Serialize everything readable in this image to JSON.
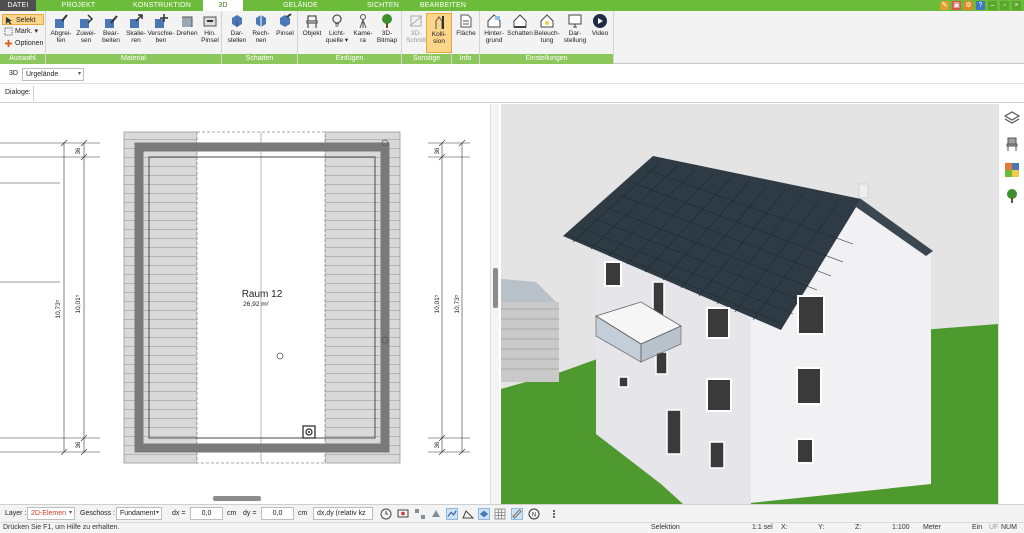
{
  "tabs": [
    {
      "label": "DATEI"
    },
    {
      "label": "PROJEKT"
    },
    {
      "label": "KONSTRUKTION"
    },
    {
      "label": "3D"
    },
    {
      "label": "GELÄNDE"
    },
    {
      "label": "SICHTEN"
    },
    {
      "label": "BEARBEITEN"
    }
  ],
  "window_controls": [
    "–",
    "▫",
    "×"
  ],
  "ribbon": {
    "auswahl": {
      "label": "Auswahl",
      "selekt": "Selekt",
      "mark": "Mark. ▾",
      "optionen": "Optionen"
    },
    "material": {
      "label": "Material",
      "buttons": [
        "Abgrei-\nfen",
        "Zuwei-\nsen",
        "Bear-\nbeiten",
        "Skalie-\nren",
        "Verschie-\nben",
        "Drehen",
        "Hin.\nPinsel"
      ]
    },
    "schatten": {
      "label": "Schatten",
      "buttons": [
        "Dar-\nstellen",
        "Rech-\nnen",
        "Pinsel"
      ]
    },
    "einfuegen": {
      "label": "Einfügen",
      "buttons": [
        "Objekt",
        "Licht-\nquelle ▾",
        "Kame-\nra",
        "3D-\nBitmap"
      ]
    },
    "sonstige": {
      "label": "Sonstige",
      "buttons": [
        "3D-\nSchnitt",
        "Kolli-\nsion"
      ]
    },
    "info": {
      "label": "Info",
      "buttons": [
        "Fläche"
      ]
    },
    "einstellungen": {
      "label": "Einstellungen",
      "buttons": [
        "Hinter-\ngrund",
        "Schatten",
        "Beleuch-\ntung",
        "Dar-\nstellung",
        "Video"
      ]
    }
  },
  "subbar": {
    "view_mode": "3D",
    "terrain_select": "Urgelände",
    "dialoge": "Dialoge:"
  },
  "plan": {
    "room_name": "Raum 12",
    "room_area": "26,92 m²",
    "dim_outer": "10,73⁵",
    "dim_inner": "10,01⁵",
    "dim_small": "36"
  },
  "bottombar": {
    "layer_label": "Layer :",
    "layer_value": "2D-Elemen",
    "geschoss_label": "Geschoss :",
    "geschoss_value": "Fundament",
    "dx_label": "dx =",
    "dx_value": "0,0",
    "dy_label": "dy =",
    "dy_value": "0,0",
    "unit": "cm",
    "mode_value": "dx,dy (relativ kz"
  },
  "status": {
    "help": "Drücken Sie F1, um Hilfe zu erhalten.",
    "mode": "Selektion",
    "sel": "1:1 sel",
    "x": "X:",
    "y": "Y:",
    "z": "Z:",
    "scale": "1:100",
    "unit": "Meter",
    "ein": "Ein",
    "uf": "UF",
    "num": "NUM"
  },
  "colors": {
    "accent_green": "#6dbb3a",
    "group_label_green": "#8cc75c",
    "active_orange": "#fbd58a",
    "roof": "#2e3b45",
    "lawn": "#4f9a2e"
  }
}
